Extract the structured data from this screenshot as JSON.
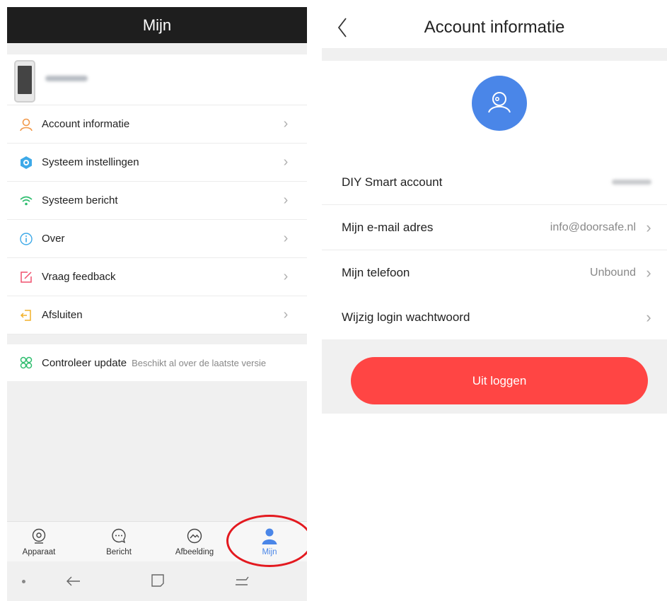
{
  "left": {
    "header_title": "Mijn",
    "menu": [
      {
        "label": "Account informatie",
        "icon": "person-icon"
      },
      {
        "label": "Systeem instellingen",
        "icon": "settings-hex-icon"
      },
      {
        "label": "Systeem bericht",
        "icon": "wifi-icon"
      },
      {
        "label": "Over",
        "icon": "info-icon"
      },
      {
        "label": "Vraag feedback",
        "icon": "edit-icon"
      },
      {
        "label": "Afsluiten",
        "icon": "exit-icon"
      }
    ],
    "update": {
      "label": "Controleer update",
      "status": "Beschikt al over de laatste versie"
    },
    "tabs": [
      {
        "label": "Apparaat",
        "icon": "camera-icon"
      },
      {
        "label": "Bericht",
        "icon": "chat-icon"
      },
      {
        "label": "Afbeelding",
        "icon": "image-icon"
      },
      {
        "label": "Mijn",
        "icon": "user-icon",
        "active": true
      }
    ]
  },
  "right": {
    "title": "Account informatie",
    "rows": [
      {
        "label": "DIY Smart account",
        "value": ""
      },
      {
        "label": "Mijn e-mail adres",
        "value": "info@doorsafe.nl"
      },
      {
        "label": "Mijn telefoon",
        "value": "Unbound"
      },
      {
        "label": "Wijzig login wachtwoord",
        "value": ""
      }
    ],
    "logout_label": "Uit loggen"
  },
  "colors": {
    "accent_blue": "#4a86e8",
    "logout_red": "#ff4544",
    "annotation_red": "#e3191f",
    "header_dark": "#1e1e1e"
  }
}
